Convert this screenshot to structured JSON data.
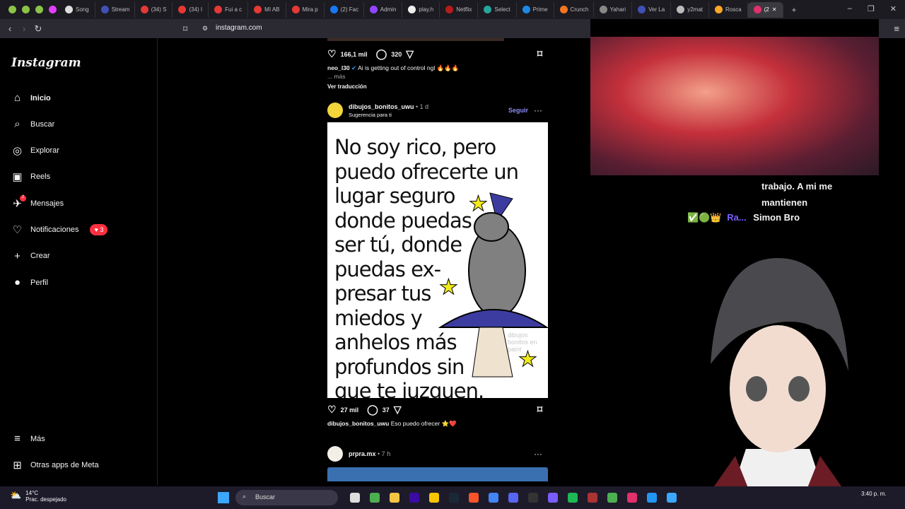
{
  "browser": {
    "tabs": [
      {
        "label": "",
        "color": "#8bc34a",
        "pinned": true
      },
      {
        "label": "",
        "color": "#8bc34a",
        "pinned": true
      },
      {
        "label": "",
        "color": "#8bc34a",
        "pinned": true
      },
      {
        "label": "",
        "color": "#e040fb",
        "pinned": true
      },
      {
        "label": "Song",
        "color": "#ddd"
      },
      {
        "label": "Stream",
        "color": "#3f51b5"
      },
      {
        "label": "(34) S",
        "color": "#e53935"
      },
      {
        "label": "(34) I",
        "color": "#e53935"
      },
      {
        "label": "Fui a c",
        "color": "#e53935"
      },
      {
        "label": "MI AB",
        "color": "#e53935"
      },
      {
        "label": "Mira p",
        "color": "#e53935"
      },
      {
        "label": "(2) Fac",
        "color": "#1877f2"
      },
      {
        "label": "Admin",
        "color": "#9146ff"
      },
      {
        "label": "play.h",
        "color": "#eee"
      },
      {
        "label": "Netflix",
        "color": "#b71c1c"
      },
      {
        "label": "Select",
        "color": "#26a69a"
      },
      {
        "label": "Prime",
        "color": "#1e88e5"
      },
      {
        "label": "Crunch",
        "color": "#f47521"
      },
      {
        "label": "Yahari",
        "color": "#888"
      },
      {
        "label": "Ver La",
        "color": "#3f51b5"
      },
      {
        "label": "y2mat",
        "color": "#bbb"
      },
      {
        "label": "Rosca",
        "color": "#f9a825"
      },
      {
        "label": "(2",
        "color": "#e1306c",
        "active": true
      }
    ],
    "new_tab": "+",
    "url": "instagram.com",
    "window": {
      "min": "–",
      "max": "❐",
      "close": "✕"
    }
  },
  "sidebar": {
    "logo": "Instagram",
    "items": [
      {
        "label": "Inicio",
        "icon": "⌂",
        "name": "home"
      },
      {
        "label": "Buscar",
        "icon": "⌕",
        "name": "search"
      },
      {
        "label": "Explorar",
        "icon": "◎",
        "name": "explore"
      },
      {
        "label": "Reels",
        "icon": "▣",
        "name": "reels"
      },
      {
        "label": "Mensajes",
        "icon": "✈",
        "name": "messages",
        "count": "2"
      },
      {
        "label": "Notificaciones",
        "icon": "♡",
        "name": "notifications",
        "badge": "♥ 3"
      },
      {
        "label": "Crear",
        "icon": "+",
        "name": "create"
      },
      {
        "label": "Perfil",
        "icon": "●",
        "name": "profile"
      }
    ],
    "more": "Más",
    "meta": "Otras apps de Meta"
  },
  "feed": {
    "post1": {
      "likes": "166,1 mil",
      "comments": "320",
      "user": "neo_l30",
      "caption": "Ai is getting out of control ngl 🔥🔥🔥",
      "more": "... más",
      "translate": "Ver traducción"
    },
    "post2": {
      "user": "dibujos_bonitos_uwu",
      "time": "• 1 d",
      "subtitle": "Sugerencia para ti",
      "follow": "Seguir",
      "image_text": [
        "No soy rico, pero",
        "puedo ofrecerte un",
        "lugar seguro",
        "donde puedas",
        "ser tú, donde",
        "puedas ex-",
        "presar tus",
        "miedos y",
        "anhelos más",
        "profundos sin",
        "que te juzguen."
      ],
      "watermark": "dibujos bonitos en paint",
      "likes": "27 mil",
      "comments": "37",
      "caption": "Eso puedo ofrecer ⭐❤️"
    },
    "post3": {
      "user": "prpra.mx",
      "time": "• 7 h"
    }
  },
  "stream_chat": {
    "lines": [
      "trabajo. A mi me",
      "mantienen"
    ],
    "user": "Ra...",
    "message": "Simon Bro"
  },
  "taskbar": {
    "weather_temp": "14°C",
    "weather_desc": "Prac. despejado",
    "search": "Buscar",
    "time": "3:40 p. m."
  }
}
